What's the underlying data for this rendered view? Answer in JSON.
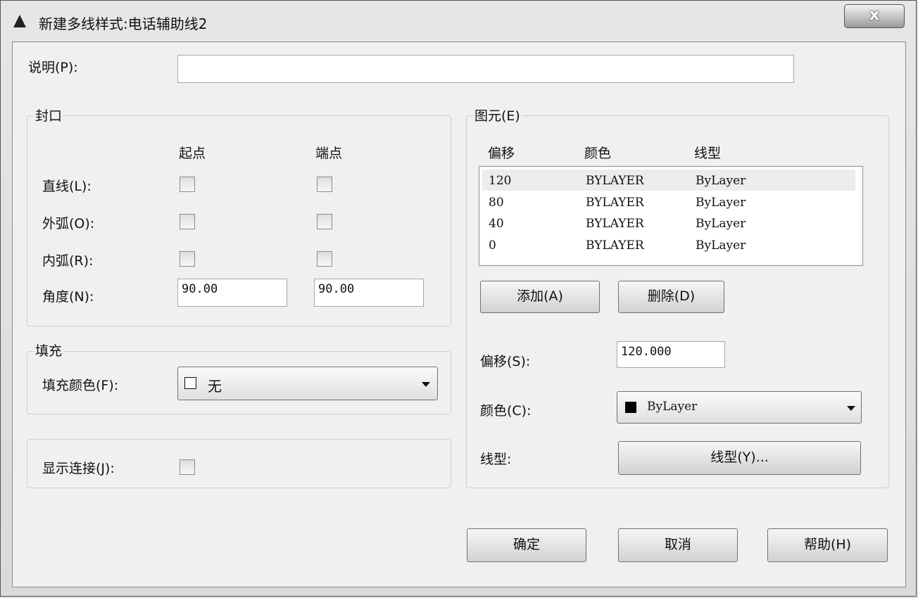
{
  "window": {
    "title": "新建多线样式:电话辅助线2",
    "close_label": "x"
  },
  "description": {
    "label": "说明(P):",
    "value": ""
  },
  "caps": {
    "group_label": "封口",
    "col_start": "起点",
    "col_end": "端点",
    "rows": [
      {
        "label": "直线(L):",
        "start": false,
        "end": false
      },
      {
        "label": "外弧(O):",
        "start": false,
        "end": false
      },
      {
        "label": "内弧(R):",
        "start": false,
        "end": false
      }
    ],
    "angle_label": "角度(N):",
    "angle_start": "90.00",
    "angle_end": "90.00"
  },
  "fill": {
    "group_label": "填充",
    "label": "填充颜色(F):",
    "value": "无"
  },
  "joints": {
    "label": "显示连接(J):",
    "checked": false
  },
  "elements": {
    "group_label": "图元(E)",
    "headers": {
      "offset": "偏移",
      "color": "颜色",
      "linetype": "线型"
    },
    "rows": [
      {
        "offset": "120",
        "color": "BYLAYER",
        "linetype": "ByLayer"
      },
      {
        "offset": "80",
        "color": "BYLAYER",
        "linetype": "ByLayer"
      },
      {
        "offset": "40",
        "color": "BYLAYER",
        "linetype": "ByLayer"
      },
      {
        "offset": "0",
        "color": "BYLAYER",
        "linetype": "ByLayer"
      }
    ],
    "add_label": "添加(A)",
    "delete_label": "删除(D)",
    "offset_label": "偏移(S):",
    "offset_value": "120.000",
    "color_label": "颜色(C):",
    "color_value": "ByLayer",
    "color_swatch": "#000000",
    "linetype_label": "线型:",
    "linetype_button": "线型(Y)..."
  },
  "footer": {
    "ok_label": "确定",
    "cancel_label": "取消",
    "help_label": "帮助(H)"
  }
}
